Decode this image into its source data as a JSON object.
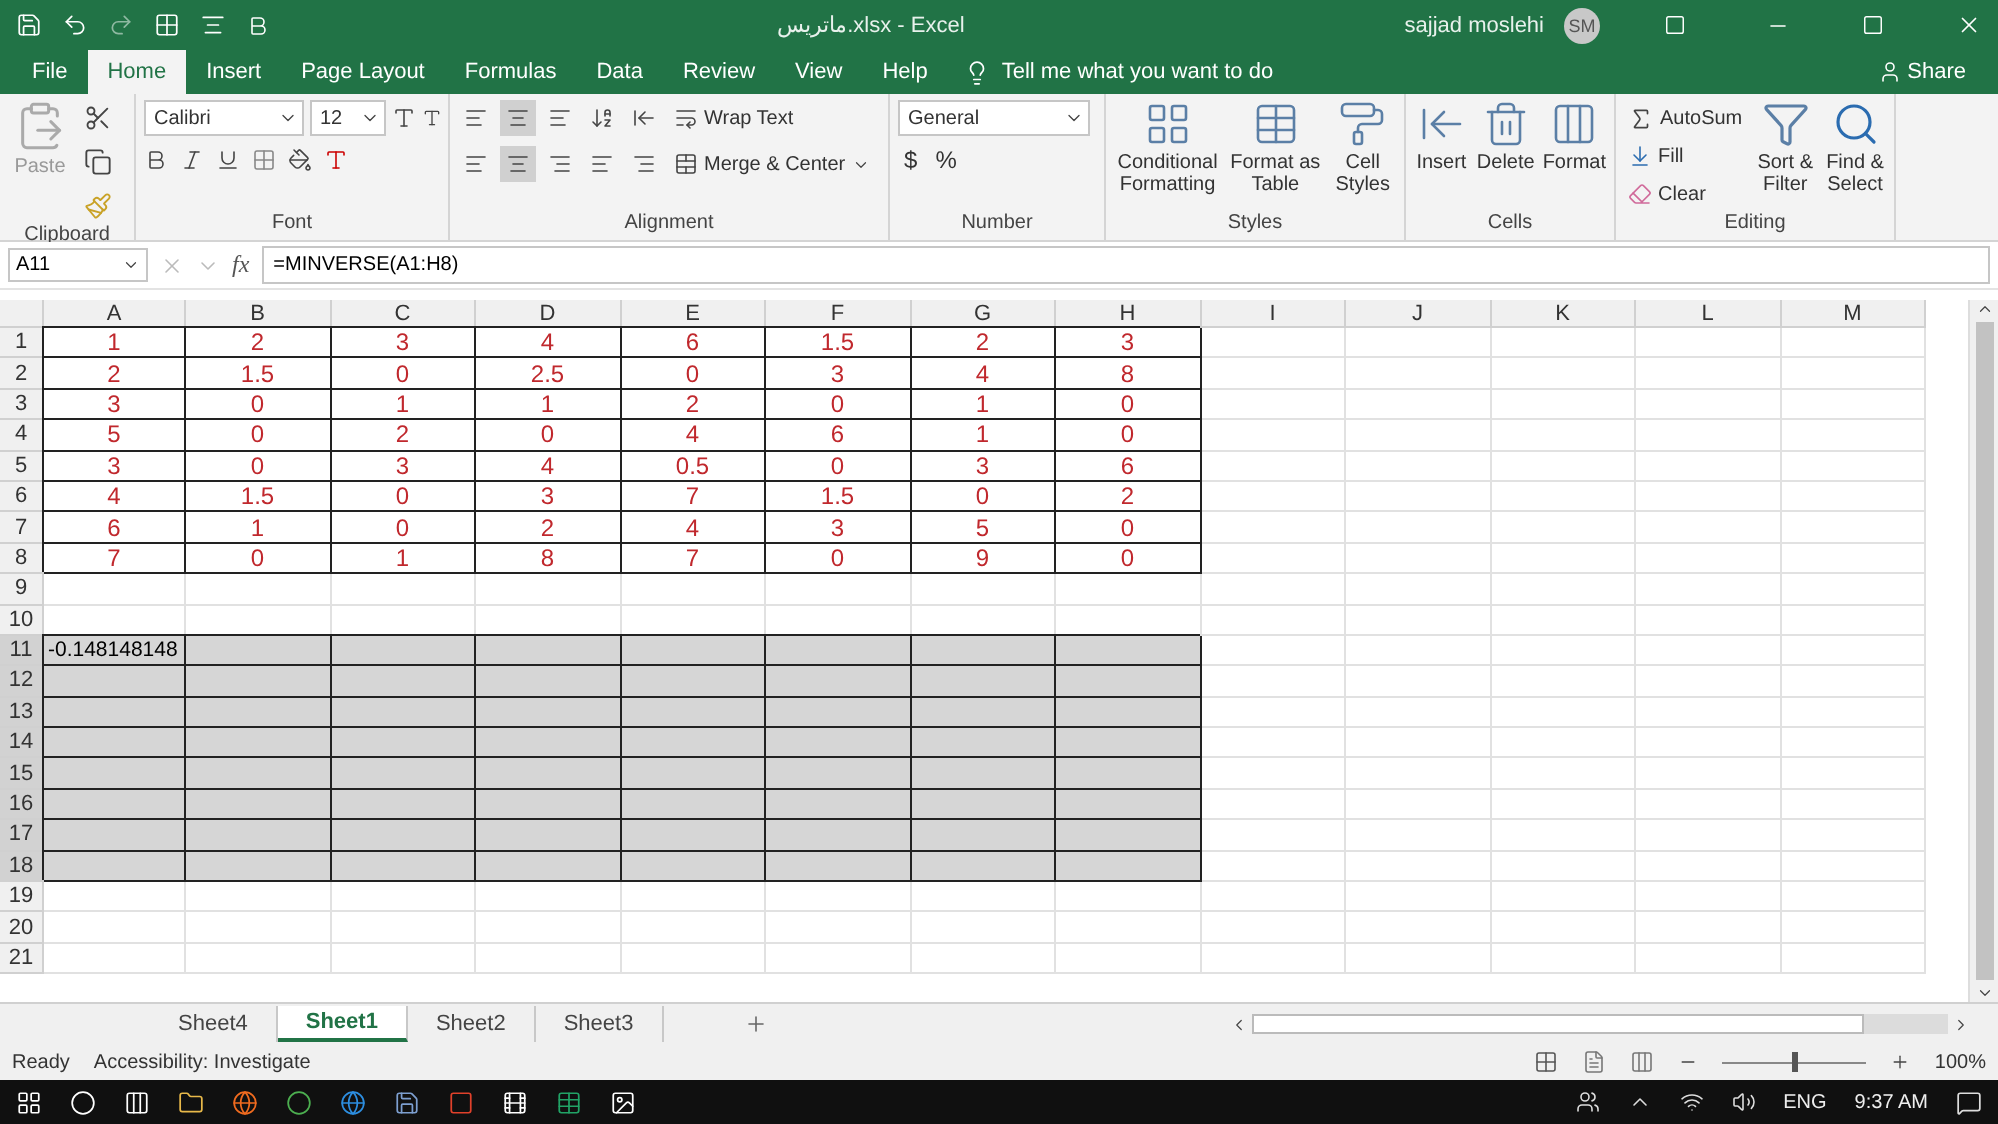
{
  "window": {
    "title": "ماتریس.xlsx - Excel",
    "user": "sajjad moslehi",
    "avatar": "SM"
  },
  "tabs": [
    {
      "label": "File",
      "selected": false
    },
    {
      "label": "Home",
      "selected": true
    },
    {
      "label": "Insert",
      "selected": false
    },
    {
      "label": "Page Layout",
      "selected": false
    },
    {
      "label": "Formulas",
      "selected": false
    },
    {
      "label": "Data",
      "selected": false
    },
    {
      "label": "Review",
      "selected": false
    },
    {
      "label": "View",
      "selected": false
    },
    {
      "label": "Help",
      "selected": false
    }
  ],
  "tell_me": "Tell me what you want to do",
  "share": "Share",
  "ribbon": {
    "groups": [
      {
        "kind": "clipboard",
        "label": "Clipboard",
        "commands": [
          "Paste"
        ]
      },
      {
        "kind": "font",
        "label": "Font",
        "commands": [
          "Calibri",
          "12"
        ]
      },
      {
        "kind": "alignment",
        "label": "Alignment",
        "commands": [
          "Wrap Text",
          "Merge & Center"
        ]
      },
      {
        "kind": "number",
        "label": "Number",
        "commands": [
          "General",
          "$",
          "%"
        ]
      },
      {
        "kind": "large",
        "label": "Styles",
        "commands": [
          "Conditional Formatting",
          "Format as Table",
          "Cell Styles"
        ]
      },
      {
        "kind": "large",
        "label": "Cells",
        "commands": [
          "Insert",
          "Delete",
          "Format"
        ]
      },
      {
        "kind": "editing",
        "label": "Editing",
        "commands": [
          "AutoSum",
          "Fill",
          "Clear",
          "Sort & Filter",
          "Find & Select"
        ]
      }
    ]
  },
  "formula_bar": {
    "name_box": "A11",
    "function_label": "fx",
    "formula": "=MINVERSE(A1:H8)"
  },
  "sheet": {
    "columns": [
      "A",
      "B",
      "C",
      "D",
      "E",
      "F",
      "G",
      "H",
      "I",
      "J",
      "K",
      "L",
      "M"
    ],
    "rows": [
      {
        "label": "1",
        "kind": "data",
        "selected": false,
        "cells": [
          "1",
          "2",
          "3",
          "4",
          "6",
          "1.5",
          "2",
          "3"
        ]
      },
      {
        "label": "2",
        "kind": "data",
        "selected": false,
        "cells": [
          "2",
          "1.5",
          "0",
          "2.5",
          "0",
          "3",
          "4",
          "8"
        ]
      },
      {
        "label": "3",
        "kind": "data",
        "selected": false,
        "cells": [
          "3",
          "0",
          "1",
          "1",
          "2",
          "0",
          "1",
          "0"
        ]
      },
      {
        "label": "4",
        "kind": "data",
        "selected": false,
        "cells": [
          "5",
          "0",
          "2",
          "0",
          "4",
          "6",
          "1",
          "0"
        ]
      },
      {
        "label": "5",
        "kind": "data",
        "selected": false,
        "cells": [
          "3",
          "0",
          "3",
          "4",
          "0.5",
          "0",
          "3",
          "6"
        ]
      },
      {
        "label": "6",
        "kind": "data",
        "selected": false,
        "cells": [
          "4",
          "1.5",
          "0",
          "3",
          "7",
          "1.5",
          "0",
          "2"
        ]
      },
      {
        "label": "7",
        "kind": "data",
        "selected": false,
        "cells": [
          "6",
          "1",
          "0",
          "2",
          "4",
          "3",
          "5",
          "0"
        ]
      },
      {
        "label": "8",
        "kind": "data",
        "selected": false,
        "cells": [
          "7",
          "0",
          "1",
          "8",
          "7",
          "0",
          "9",
          "0"
        ]
      },
      {
        "label": "9",
        "kind": "empty",
        "selected": false
      },
      {
        "label": "10",
        "kind": "empty",
        "selected": false
      },
      {
        "label": "11",
        "kind": "result",
        "selected": true,
        "cells": [
          "-0.148148148"
        ]
      },
      {
        "label": "12",
        "kind": "result",
        "selected": true
      },
      {
        "label": "13",
        "kind": "result",
        "selected": true
      },
      {
        "label": "14",
        "kind": "result",
        "selected": true
      },
      {
        "label": "15",
        "kind": "result",
        "selected": true
      },
      {
        "label": "16",
        "kind": "result",
        "selected": true
      },
      {
        "label": "17",
        "kind": "result",
        "selected": true
      },
      {
        "label": "18",
        "kind": "result",
        "selected": true
      },
      {
        "label": "19",
        "kind": "empty",
        "selected": false
      },
      {
        "label": "20",
        "kind": "empty",
        "selected": false
      },
      {
        "label": "21",
        "kind": "empty",
        "selected": false
      }
    ]
  },
  "sheet_tabs": [
    {
      "label": "Sheet4",
      "selected": false
    },
    {
      "label": "Sheet1",
      "selected": true
    },
    {
      "label": "Sheet2",
      "selected": false
    },
    {
      "label": "Sheet3",
      "selected": false
    }
  ],
  "status_bar": {
    "mode": "Ready",
    "accessibility": "Accessibility: Investigate",
    "zoom": "100%",
    "zoom_slider": {
      "level": 0.5
    }
  },
  "taskbar": {
    "language": "ENG",
    "time": "9:37 AM"
  }
}
